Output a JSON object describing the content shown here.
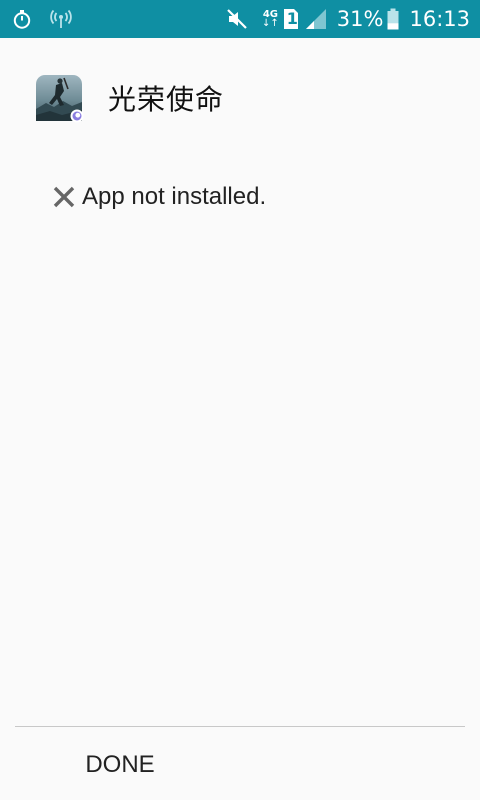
{
  "status_bar": {
    "network_label": "4G",
    "sim_number": "1",
    "battery_percent": "31%",
    "time": "16:13",
    "background_color": "#0f8fa3",
    "icons": [
      "stopwatch-icon",
      "wifi-hotspot-icon",
      "mute-icon",
      "sim-icon",
      "signal-icon",
      "battery-icon"
    ]
  },
  "app": {
    "name": "光荣使命",
    "icon": "game-app-icon"
  },
  "message": {
    "icon": "close-x-icon",
    "text": "App not installed."
  },
  "footer": {
    "done_label": "DONE"
  }
}
